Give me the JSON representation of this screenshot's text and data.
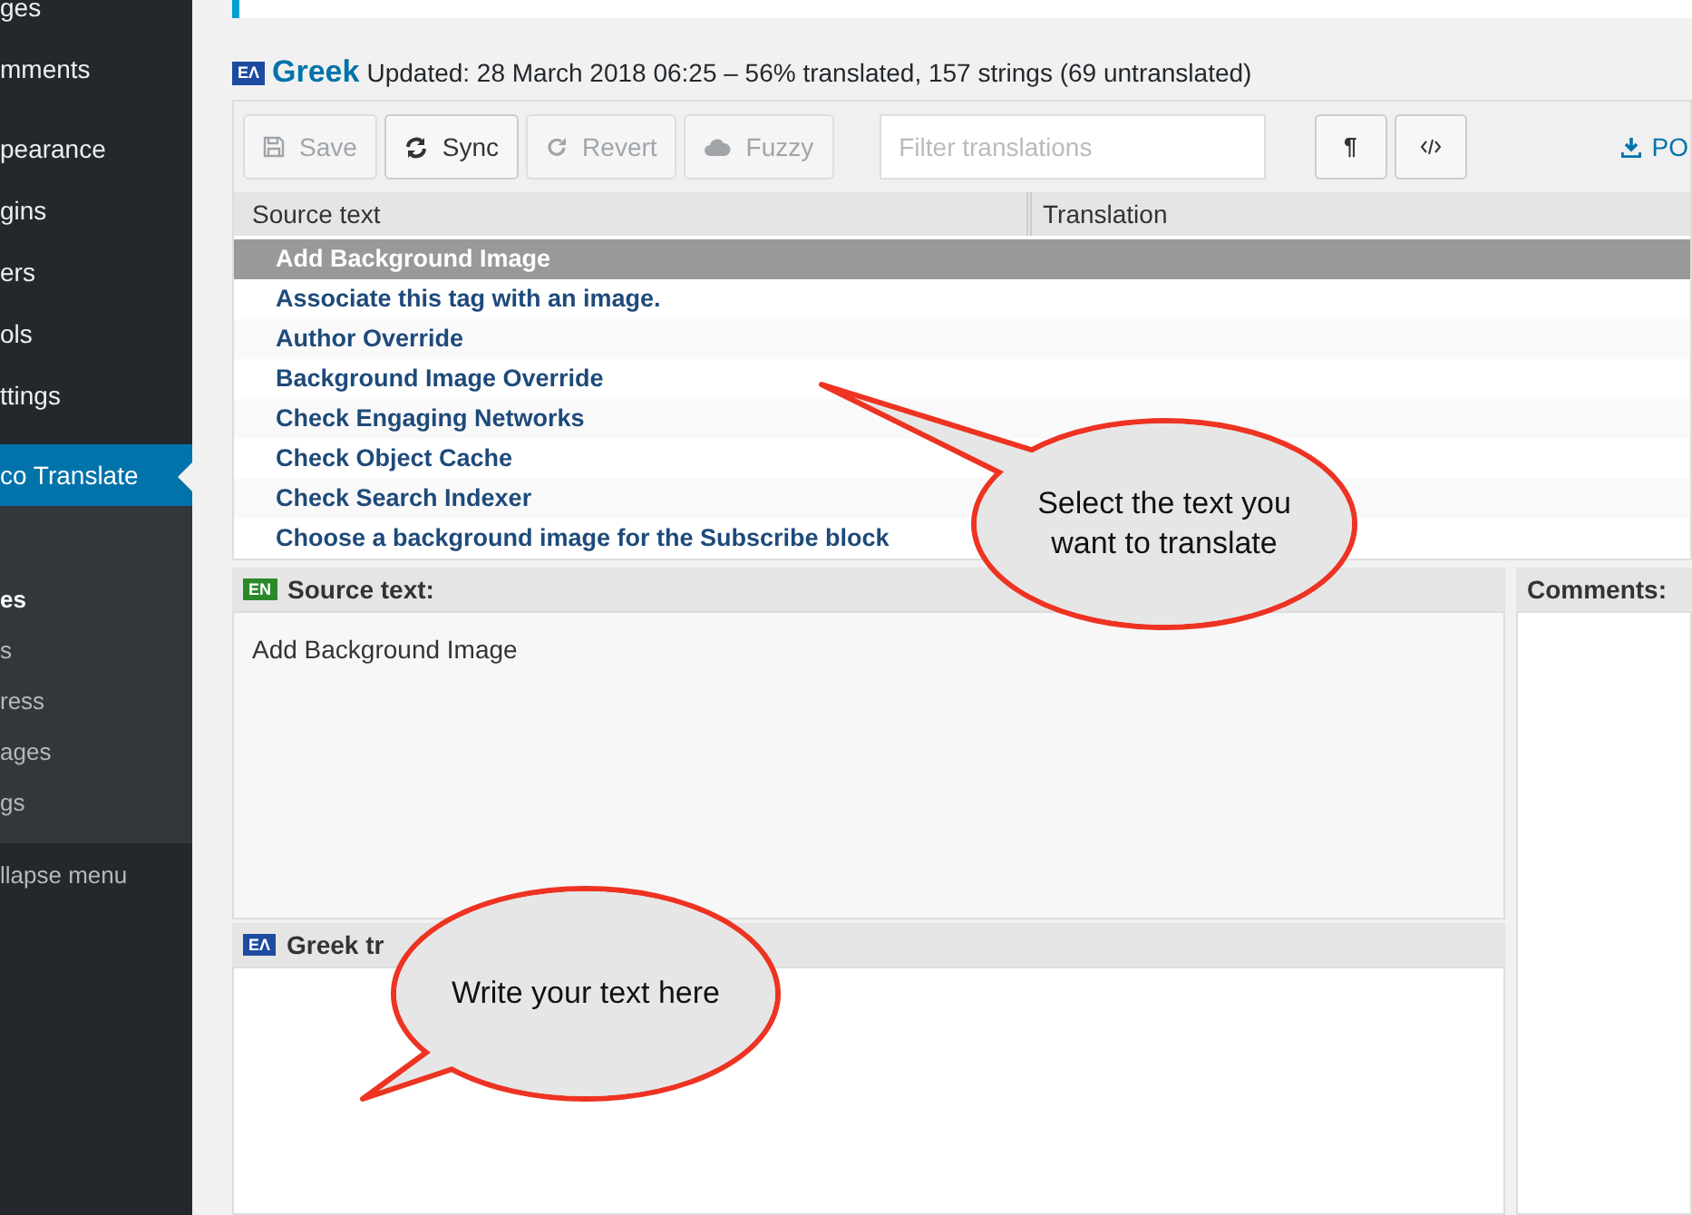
{
  "sidebar": {
    "items": [
      {
        "label": "ges",
        "selected": false
      },
      {
        "label": "mments",
        "selected": false
      },
      {
        "label": "pearance",
        "selected": false
      },
      {
        "label": "gins",
        "selected": false
      },
      {
        "label": "ers",
        "selected": false
      },
      {
        "label": "ols",
        "selected": false
      },
      {
        "label": "ttings",
        "selected": false
      },
      {
        "label": "co Translate",
        "selected": true
      }
    ],
    "submenu": [
      {
        "label": "es",
        "selected": true
      },
      {
        "label": "s",
        "selected": false
      },
      {
        "label": "ress",
        "selected": false
      },
      {
        "label": "ages",
        "selected": false
      },
      {
        "label": "gs",
        "selected": false
      }
    ],
    "collapse": "llapse menu"
  },
  "header": {
    "flag": "ΕΛ",
    "language": "Greek",
    "summary": "Updated: 28 March 2018 06:25 – 56% translated, 157 strings (69 untranslated)"
  },
  "toolbar": {
    "buttons": [
      {
        "label": "Save",
        "kind": "save",
        "disabled": true
      },
      {
        "label": "Sync",
        "kind": "sync",
        "disabled": false
      },
      {
        "label": "Revert",
        "kind": "revert",
        "disabled": true
      },
      {
        "label": "Fuzzy",
        "kind": "fuzzy",
        "disabled": true
      }
    ],
    "filter": {
      "placeholder": "Filter translations"
    },
    "toggles": [
      {
        "label": "¶",
        "kind": "text"
      },
      {
        "kind": "code"
      }
    ],
    "download": "PO"
  },
  "table": {
    "columns": [
      "Source text",
      "Translation"
    ],
    "rows": [
      {
        "source": "Add Background Image",
        "selected": true
      },
      {
        "source": "Associate this tag with an image.",
        "selected": false
      },
      {
        "source": "Author Override",
        "selected": false
      },
      {
        "source": "Background Image Override",
        "selected": false
      },
      {
        "source": "Check Engaging Networks",
        "selected": false
      },
      {
        "source": "Check Object Cache",
        "selected": false
      },
      {
        "source": "Check Search Indexer",
        "selected": false
      },
      {
        "source": "Choose a background image for the Subscribe block",
        "selected": false
      }
    ]
  },
  "source_panel": {
    "flag": "EN",
    "title": "Source text:",
    "text": "Add Background Image"
  },
  "comments_panel": {
    "title": "Comments:"
  },
  "target_panel": {
    "flag": "ΕΛ",
    "title": "Greek tr"
  },
  "callouts": [
    {
      "text": "Select the text you want to translate"
    },
    {
      "text": "Write your text here"
    }
  ]
}
